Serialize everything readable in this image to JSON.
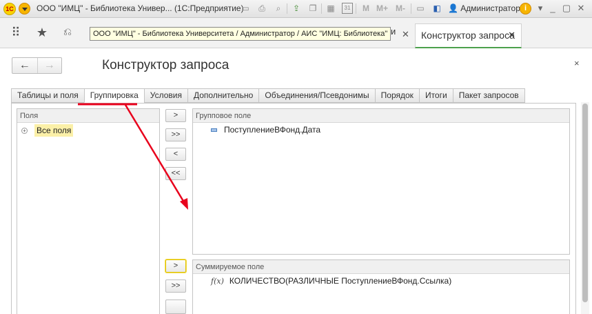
{
  "titlebar": {
    "logo_text": "1С",
    "title": "ООО \"ИМЦ\" - Библиотека Универ...   (1С:Предприятие)",
    "icons": [
      "save-icon",
      "print-icon",
      "preview-icon",
      "upload-icon",
      "copy-icon",
      "table-icon",
      "calendar-icon"
    ],
    "calendar_text": "31",
    "memory_buttons": [
      "M",
      "M+",
      "M-"
    ],
    "user": "Администратор",
    "info_label": "i"
  },
  "sectionbar": {
    "icons": [
      "apps-grid-icon",
      "favorites-star-icon",
      "history-icon"
    ],
    "tooltip": "ООО \"ИМЦ\" - Библиотека Университета / Администратор / АИС \"ИМЦ: Библиотека\"",
    "hidden_tab_fragment": "и",
    "active_tab": "Конструктор запроса"
  },
  "form": {
    "title": "Конструктор запроса",
    "back_label": "←",
    "forward_label": "→",
    "close_label": "×"
  },
  "tabs": [
    {
      "label": "Таблицы и поля",
      "active": false
    },
    {
      "label": "Группировка",
      "active": true
    },
    {
      "label": "Условия",
      "active": false
    },
    {
      "label": "Дополнительно",
      "active": false
    },
    {
      "label": "Объединения/Псевдонимы",
      "active": false
    },
    {
      "label": "Порядок",
      "active": false
    },
    {
      "label": "Итоги",
      "active": false
    },
    {
      "label": "Пакет запросов",
      "active": false
    }
  ],
  "fields_panel": {
    "header": "Поля",
    "items": [
      "Все поля"
    ]
  },
  "move_buttons": {
    "group": [
      ">",
      ">>",
      "<",
      "<<"
    ],
    "sum": [
      ">",
      ">>"
    ]
  },
  "group_panel": {
    "header": "Групповое поле",
    "items": [
      "ПоступлениеВФонд.Дата"
    ]
  },
  "sum_panel": {
    "header": "Суммируемое поле",
    "items": [
      "КОЛИЧЕСТВО(РАЗЛИЧНЫЕ ПоступлениеВФонд.Ссылка)"
    ],
    "fx_label": "f(x)"
  },
  "annotation_color": "#e8001c"
}
